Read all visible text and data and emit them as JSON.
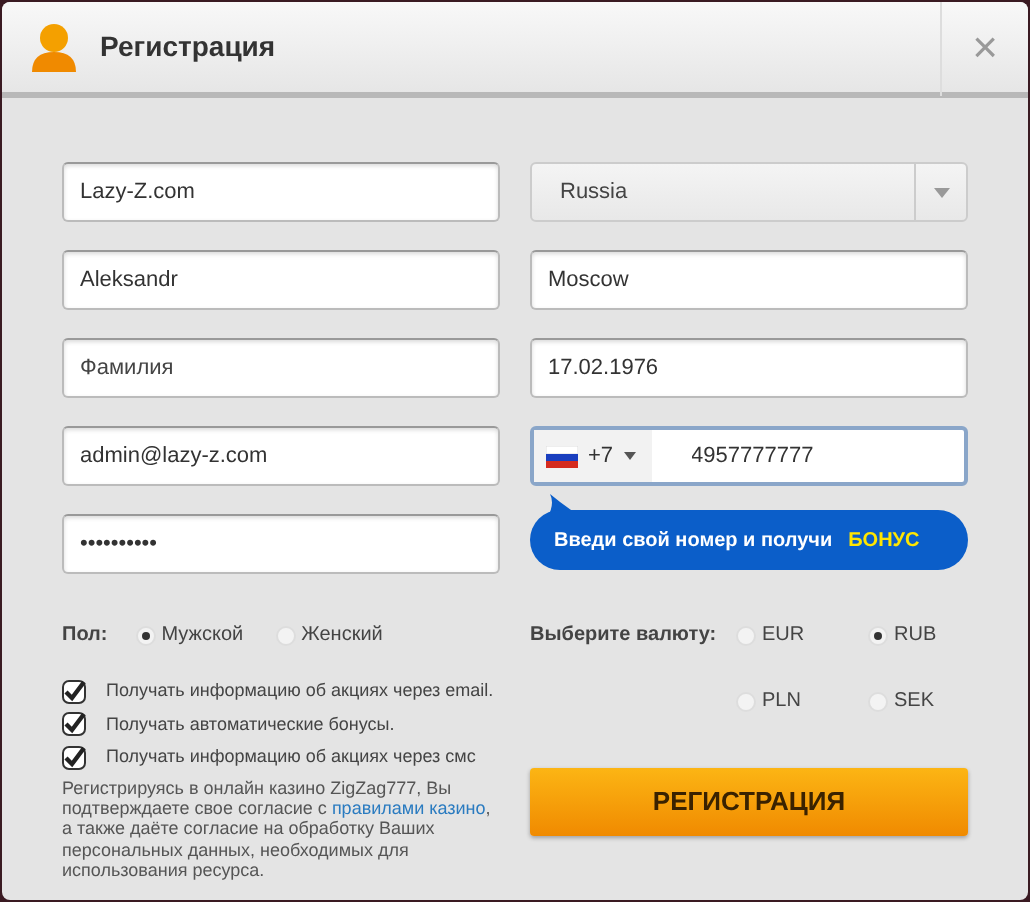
{
  "window": {
    "title": "Регистрация",
    "close": "×"
  },
  "left_fields": [
    {
      "value": "Lazy-Z.com"
    },
    {
      "value": "Aleksandr"
    },
    {
      "placeholder": "Фамилия"
    },
    {
      "value": "admin@lazy-z.com"
    },
    {
      "value": "••••••••••"
    }
  ],
  "country": {
    "value": "Russia"
  },
  "right_fields": [
    {
      "value": "Moscow"
    },
    {
      "value": "17.02.1976"
    }
  ],
  "phone": {
    "code": "+7",
    "number": "4957777777"
  },
  "promo": {
    "text": "Введи свой номер и получи",
    "highlight": "БОНУС"
  },
  "gender": {
    "label": "Пол:",
    "options": [
      {
        "label": "Мужской",
        "selected": true
      },
      {
        "label": "Женский",
        "selected": false
      }
    ]
  },
  "checkboxes": [
    {
      "label": "Получать информацию об акциях через email.",
      "checked": true
    },
    {
      "label": "Получать автоматические бонусы.",
      "checked": true
    },
    {
      "label": "Получать информацию об акциях через смс",
      "checked": true
    }
  ],
  "consent": {
    "before": "Регистрируясь в онлайн казино ZigZag777, Вы подтверждаете свое согласие с",
    "link": "правилами казино",
    "after": ", а также даёте согласие на обработку Ваших персональных данных, необходимых для использования ресурса."
  },
  "currency": {
    "label": "Выберите валюту:",
    "options": [
      {
        "label": "EUR",
        "selected": false
      },
      {
        "label": "RUB",
        "selected": true
      },
      {
        "label": "PLN",
        "selected": false
      },
      {
        "label": "SEK",
        "selected": false
      }
    ]
  },
  "submit": "РЕГИСТРАЦИЯ"
}
